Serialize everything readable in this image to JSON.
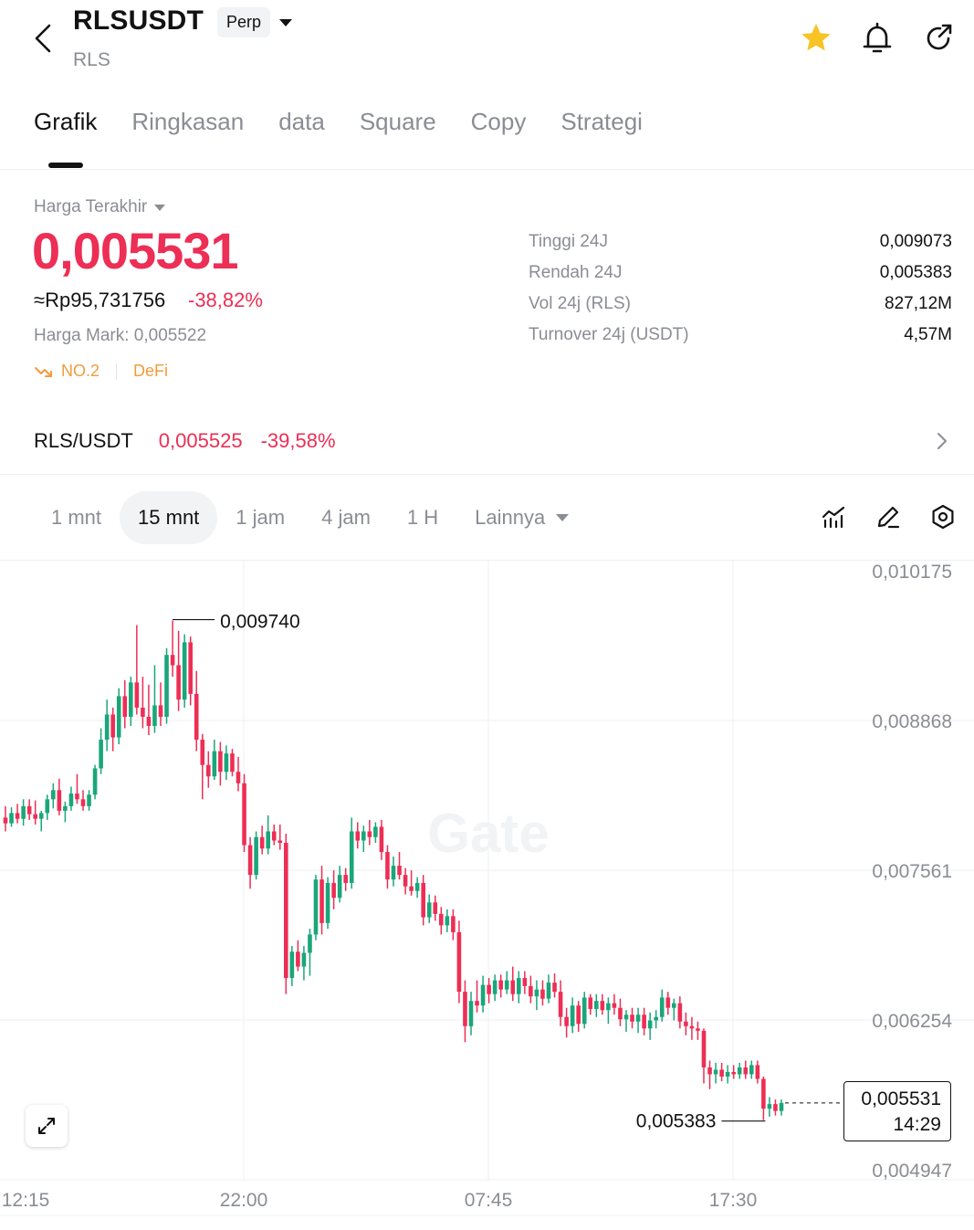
{
  "header": {
    "symbol": "RLSUSDT",
    "base": "RLS",
    "contract_tag": "Perp",
    "icons": [
      "back-icon",
      "star-icon",
      "bell-icon",
      "share-icon"
    ],
    "favorite_color": "#f7c325"
  },
  "tabs": [
    {
      "label": "Grafik",
      "active": true
    },
    {
      "label": "Ringkasan",
      "active": false
    },
    {
      "label": "data",
      "active": false
    },
    {
      "label": "Square",
      "active": false
    },
    {
      "label": "Copy",
      "active": false
    },
    {
      "label": "Strategi",
      "active": false
    }
  ],
  "price": {
    "label": "Harga Terakhir",
    "last": "0,005531",
    "idr": "≈Rp95,731756",
    "change": "-38,82%",
    "mark": "Harga Mark: 0,005522",
    "rank": "NO.2",
    "sector": "DeFi"
  },
  "stats": [
    {
      "label": "Tinggi 24J",
      "value": "0,009073"
    },
    {
      "label": "Rendah 24J",
      "value": "0,005383"
    },
    {
      "label": "Vol 24j (RLS)",
      "value": "827,12M"
    },
    {
      "label": "Turnover 24j (USDT)",
      "value": "4,57M"
    }
  ],
  "spot": {
    "pair": "RLS/USDT",
    "price": "0,005525",
    "change": "-39,58%"
  },
  "intervals": {
    "items": [
      "1 mnt",
      "15 mnt",
      "1 jam",
      "4 jam",
      "1 H"
    ],
    "selected": "15 mnt",
    "more": "Lainnya"
  },
  "colors": {
    "up": "#1aa67a",
    "down": "#ed2e55",
    "text": "#121212",
    "muted": "#8a8d93"
  },
  "chart_data": {
    "type": "candlestick",
    "interval": "15 mnt",
    "y_ticks": [
      0.010175,
      0.008868,
      0.007561,
      0.006254,
      0.004947
    ],
    "y_tick_labels": [
      "0,010175",
      "0,008868",
      "0,007561",
      "0,006254",
      "0,004947"
    ],
    "x_tick_labels": [
      "12:15",
      "22:00",
      "07:45",
      "17:30"
    ],
    "ylim": [
      0.004947,
      0.010175
    ],
    "high_marker": "0,009740",
    "low_marker": "0,005383",
    "current_price": "0,005531",
    "current_countdown": "14:29",
    "watermark": "Gate",
    "grid": true,
    "candles": [
      {
        "o": 0.00802,
        "h": 0.00812,
        "l": 0.0079,
        "c": 0.00797
      },
      {
        "o": 0.00797,
        "h": 0.00811,
        "l": 0.00794,
        "c": 0.00806
      },
      {
        "o": 0.00806,
        "h": 0.00814,
        "l": 0.00797,
        "c": 0.00801
      },
      {
        "o": 0.00801,
        "h": 0.00818,
        "l": 0.00795,
        "c": 0.00812
      },
      {
        "o": 0.00812,
        "h": 0.00818,
        "l": 0.008,
        "c": 0.00805
      },
      {
        "o": 0.00805,
        "h": 0.00817,
        "l": 0.00796,
        "c": 0.00801
      },
      {
        "o": 0.00801,
        "h": 0.00808,
        "l": 0.0079,
        "c": 0.00806
      },
      {
        "o": 0.00806,
        "h": 0.00822,
        "l": 0.008,
        "c": 0.00818
      },
      {
        "o": 0.00818,
        "h": 0.00832,
        "l": 0.0081,
        "c": 0.00826
      },
      {
        "o": 0.00826,
        "h": 0.00836,
        "l": 0.00804,
        "c": 0.00808
      },
      {
        "o": 0.00808,
        "h": 0.00816,
        "l": 0.00798,
        "c": 0.00812
      },
      {
        "o": 0.00812,
        "h": 0.00829,
        "l": 0.00808,
        "c": 0.00823
      },
      {
        "o": 0.00823,
        "h": 0.0084,
        "l": 0.00814,
        "c": 0.00818
      },
      {
        "o": 0.00818,
        "h": 0.00826,
        "l": 0.00808,
        "c": 0.00812
      },
      {
        "o": 0.00812,
        "h": 0.00826,
        "l": 0.00808,
        "c": 0.00822
      },
      {
        "o": 0.00822,
        "h": 0.00848,
        "l": 0.00818,
        "c": 0.00845
      },
      {
        "o": 0.00845,
        "h": 0.0088,
        "l": 0.0084,
        "c": 0.0087
      },
      {
        "o": 0.0087,
        "h": 0.00905,
        "l": 0.0086,
        "c": 0.00892
      },
      {
        "o": 0.00892,
        "h": 0.00898,
        "l": 0.0086,
        "c": 0.00872
      },
      {
        "o": 0.00872,
        "h": 0.00915,
        "l": 0.00866,
        "c": 0.00908
      },
      {
        "o": 0.00908,
        "h": 0.00922,
        "l": 0.0088,
        "c": 0.0089
      },
      {
        "o": 0.0089,
        "h": 0.00925,
        "l": 0.00882,
        "c": 0.0092
      },
      {
        "o": 0.0092,
        "h": 0.0097,
        "l": 0.00892,
        "c": 0.00898
      },
      {
        "o": 0.00898,
        "h": 0.00925,
        "l": 0.0088,
        "c": 0.0089
      },
      {
        "o": 0.0089,
        "h": 0.00918,
        "l": 0.00874,
        "c": 0.00882
      },
      {
        "o": 0.00882,
        "h": 0.00935,
        "l": 0.00876,
        "c": 0.009
      },
      {
        "o": 0.009,
        "h": 0.0092,
        "l": 0.00882,
        "c": 0.0089
      },
      {
        "o": 0.0089,
        "h": 0.0095,
        "l": 0.00884,
        "c": 0.00944
      },
      {
        "o": 0.00944,
        "h": 0.00974,
        "l": 0.00925,
        "c": 0.00935
      },
      {
        "o": 0.00935,
        "h": 0.00965,
        "l": 0.00895,
        "c": 0.00905
      },
      {
        "o": 0.00905,
        "h": 0.00962,
        "l": 0.00898,
        "c": 0.00955
      },
      {
        "o": 0.00955,
        "h": 0.0096,
        "l": 0.009,
        "c": 0.0091
      },
      {
        "o": 0.0091,
        "h": 0.0093,
        "l": 0.0086,
        "c": 0.0087
      },
      {
        "o": 0.0087,
        "h": 0.00875,
        "l": 0.00818,
        "c": 0.00848
      },
      {
        "o": 0.00848,
        "h": 0.0086,
        "l": 0.00828,
        "c": 0.00838
      },
      {
        "o": 0.00838,
        "h": 0.0087,
        "l": 0.00835,
        "c": 0.0086
      },
      {
        "o": 0.0086,
        "h": 0.00868,
        "l": 0.0083,
        "c": 0.00842
      },
      {
        "o": 0.00842,
        "h": 0.00865,
        "l": 0.00835,
        "c": 0.00858
      },
      {
        "o": 0.00858,
        "h": 0.00862,
        "l": 0.00838,
        "c": 0.00842
      },
      {
        "o": 0.00842,
        "h": 0.00855,
        "l": 0.00825,
        "c": 0.00832
      },
      {
        "o": 0.00832,
        "h": 0.0084,
        "l": 0.00772,
        "c": 0.00778
      },
      {
        "o": 0.00778,
        "h": 0.00785,
        "l": 0.0074,
        "c": 0.00752
      },
      {
        "o": 0.00752,
        "h": 0.0079,
        "l": 0.00748,
        "c": 0.00785
      },
      {
        "o": 0.00785,
        "h": 0.00795,
        "l": 0.0077,
        "c": 0.00775
      },
      {
        "o": 0.00775,
        "h": 0.00804,
        "l": 0.0077,
        "c": 0.0079
      },
      {
        "o": 0.0079,
        "h": 0.00796,
        "l": 0.00778,
        "c": 0.00782
      },
      {
        "o": 0.00782,
        "h": 0.00796,
        "l": 0.00774,
        "c": 0.0078
      },
      {
        "o": 0.0078,
        "h": 0.00788,
        "l": 0.00648,
        "c": 0.00662
      },
      {
        "o": 0.00662,
        "h": 0.0069,
        "l": 0.00655,
        "c": 0.00685
      },
      {
        "o": 0.00685,
        "h": 0.00695,
        "l": 0.00668,
        "c": 0.00672
      },
      {
        "o": 0.00672,
        "h": 0.0069,
        "l": 0.0066,
        "c": 0.00684
      },
      {
        "o": 0.00684,
        "h": 0.00705,
        "l": 0.00664,
        "c": 0.007
      },
      {
        "o": 0.007,
        "h": 0.00752,
        "l": 0.00695,
        "c": 0.00748
      },
      {
        "o": 0.00748,
        "h": 0.0076,
        "l": 0.007,
        "c": 0.0071
      },
      {
        "o": 0.0071,
        "h": 0.0075,
        "l": 0.00705,
        "c": 0.00745
      },
      {
        "o": 0.00745,
        "h": 0.00756,
        "l": 0.00722,
        "c": 0.00732
      },
      {
        "o": 0.00732,
        "h": 0.0076,
        "l": 0.00728,
        "c": 0.00752
      },
      {
        "o": 0.00752,
        "h": 0.00758,
        "l": 0.00738,
        "c": 0.00745
      },
      {
        "o": 0.00745,
        "h": 0.00802,
        "l": 0.0074,
        "c": 0.0079
      },
      {
        "o": 0.0079,
        "h": 0.00798,
        "l": 0.00775,
        "c": 0.00782
      },
      {
        "o": 0.00782,
        "h": 0.00795,
        "l": 0.00772,
        "c": 0.0079
      },
      {
        "o": 0.0079,
        "h": 0.008,
        "l": 0.00778,
        "c": 0.00785
      },
      {
        "o": 0.00785,
        "h": 0.00798,
        "l": 0.0078,
        "c": 0.00794
      },
      {
        "o": 0.00794,
        "h": 0.008,
        "l": 0.00765,
        "c": 0.00772
      },
      {
        "o": 0.00772,
        "h": 0.00778,
        "l": 0.0074,
        "c": 0.00748
      },
      {
        "o": 0.00748,
        "h": 0.00768,
        "l": 0.00742,
        "c": 0.0076
      },
      {
        "o": 0.0076,
        "h": 0.00772,
        "l": 0.00748,
        "c": 0.00752
      },
      {
        "o": 0.00752,
        "h": 0.00758,
        "l": 0.00735,
        "c": 0.00742
      },
      {
        "o": 0.00742,
        "h": 0.00756,
        "l": 0.00734,
        "c": 0.00738
      },
      {
        "o": 0.00738,
        "h": 0.0075,
        "l": 0.00732,
        "c": 0.00745
      },
      {
        "o": 0.00745,
        "h": 0.00752,
        "l": 0.00708,
        "c": 0.00715
      },
      {
        "o": 0.00715,
        "h": 0.00735,
        "l": 0.0071,
        "c": 0.00728
      },
      {
        "o": 0.00728,
        "h": 0.00734,
        "l": 0.00712,
        "c": 0.00718
      },
      {
        "o": 0.00718,
        "h": 0.00724,
        "l": 0.007,
        "c": 0.00708
      },
      {
        "o": 0.00708,
        "h": 0.00722,
        "l": 0.00702,
        "c": 0.00716
      },
      {
        "o": 0.00716,
        "h": 0.00722,
        "l": 0.00695,
        "c": 0.00702
      },
      {
        "o": 0.00702,
        "h": 0.00712,
        "l": 0.0064,
        "c": 0.0065
      },
      {
        "o": 0.0065,
        "h": 0.0066,
        "l": 0.00606,
        "c": 0.0062
      },
      {
        "o": 0.0062,
        "h": 0.0065,
        "l": 0.00612,
        "c": 0.00642
      },
      {
        "o": 0.00642,
        "h": 0.0066,
        "l": 0.00632,
        "c": 0.00638
      },
      {
        "o": 0.00638,
        "h": 0.00664,
        "l": 0.00632,
        "c": 0.00656
      },
      {
        "o": 0.00656,
        "h": 0.00662,
        "l": 0.0064,
        "c": 0.00648
      },
      {
        "o": 0.00648,
        "h": 0.00665,
        "l": 0.00642,
        "c": 0.0066
      },
      {
        "o": 0.0066,
        "h": 0.00665,
        "l": 0.00645,
        "c": 0.00652
      },
      {
        "o": 0.00652,
        "h": 0.00668,
        "l": 0.00648,
        "c": 0.0066
      },
      {
        "o": 0.0066,
        "h": 0.00672,
        "l": 0.00642,
        "c": 0.00648
      },
      {
        "o": 0.00648,
        "h": 0.00668,
        "l": 0.0064,
        "c": 0.00662
      },
      {
        "o": 0.00662,
        "h": 0.00668,
        "l": 0.00648,
        "c": 0.00655
      },
      {
        "o": 0.00655,
        "h": 0.00664,
        "l": 0.0064,
        "c": 0.00646
      },
      {
        "o": 0.00646,
        "h": 0.0066,
        "l": 0.00634,
        "c": 0.00652
      },
      {
        "o": 0.00652,
        "h": 0.0066,
        "l": 0.00638,
        "c": 0.00644
      },
      {
        "o": 0.00644,
        "h": 0.00665,
        "l": 0.0064,
        "c": 0.00658
      },
      {
        "o": 0.00658,
        "h": 0.00666,
        "l": 0.00645,
        "c": 0.0065
      },
      {
        "o": 0.0065,
        "h": 0.0066,
        "l": 0.0062,
        "c": 0.00628
      },
      {
        "o": 0.00628,
        "h": 0.00636,
        "l": 0.0061,
        "c": 0.0062
      },
      {
        "o": 0.0062,
        "h": 0.00645,
        "l": 0.00614,
        "c": 0.00638
      },
      {
        "o": 0.00638,
        "h": 0.00642,
        "l": 0.00615,
        "c": 0.00622
      },
      {
        "o": 0.00622,
        "h": 0.0065,
        "l": 0.00618,
        "c": 0.00645
      },
      {
        "o": 0.00645,
        "h": 0.00648,
        "l": 0.0063,
        "c": 0.00635
      },
      {
        "o": 0.00635,
        "h": 0.00648,
        "l": 0.00628,
        "c": 0.00642
      },
      {
        "o": 0.00642,
        "h": 0.00648,
        "l": 0.0063,
        "c": 0.00634
      },
      {
        "o": 0.00634,
        "h": 0.00645,
        "l": 0.00622,
        "c": 0.0064
      },
      {
        "o": 0.0064,
        "h": 0.00648,
        "l": 0.0063,
        "c": 0.00636
      },
      {
        "o": 0.00636,
        "h": 0.00644,
        "l": 0.0062,
        "c": 0.00626
      },
      {
        "o": 0.00626,
        "h": 0.00634,
        "l": 0.00615,
        "c": 0.0063
      },
      {
        "o": 0.0063,
        "h": 0.00636,
        "l": 0.00618,
        "c": 0.00624
      },
      {
        "o": 0.00624,
        "h": 0.00636,
        "l": 0.00614,
        "c": 0.0063
      },
      {
        "o": 0.0063,
        "h": 0.00636,
        "l": 0.00612,
        "c": 0.00618
      },
      {
        "o": 0.00618,
        "h": 0.00632,
        "l": 0.00608,
        "c": 0.00625
      },
      {
        "o": 0.00625,
        "h": 0.00634,
        "l": 0.00618,
        "c": 0.00628
      },
      {
        "o": 0.00628,
        "h": 0.00652,
        "l": 0.00624,
        "c": 0.00645
      },
      {
        "o": 0.00645,
        "h": 0.0065,
        "l": 0.0063,
        "c": 0.00636
      },
      {
        "o": 0.00636,
        "h": 0.00644,
        "l": 0.00625,
        "c": 0.0064
      },
      {
        "o": 0.0064,
        "h": 0.00646,
        "l": 0.00618,
        "c": 0.00624
      },
      {
        "o": 0.00624,
        "h": 0.00632,
        "l": 0.00612,
        "c": 0.0062
      },
      {
        "o": 0.0062,
        "h": 0.00628,
        "l": 0.00608,
        "c": 0.00618
      },
      {
        "o": 0.00618,
        "h": 0.00624,
        "l": 0.00608,
        "c": 0.00616
      },
      {
        "o": 0.00616,
        "h": 0.00618,
        "l": 0.0057,
        "c": 0.00584
      },
      {
        "o": 0.00584,
        "h": 0.0059,
        "l": 0.00565,
        "c": 0.00578
      },
      {
        "o": 0.00578,
        "h": 0.00588,
        "l": 0.0057,
        "c": 0.00582
      },
      {
        "o": 0.00582,
        "h": 0.00588,
        "l": 0.00572,
        "c": 0.00576
      },
      {
        "o": 0.00576,
        "h": 0.00586,
        "l": 0.0057,
        "c": 0.0058
      },
      {
        "o": 0.0058,
        "h": 0.00586,
        "l": 0.00574,
        "c": 0.00578
      },
      {
        "o": 0.00578,
        "h": 0.00588,
        "l": 0.00574,
        "c": 0.00584
      },
      {
        "o": 0.00584,
        "h": 0.0059,
        "l": 0.00574,
        "c": 0.00578
      },
      {
        "o": 0.00578,
        "h": 0.0059,
        "l": 0.00574,
        "c": 0.00586
      },
      {
        "o": 0.00586,
        "h": 0.0059,
        "l": 0.0057,
        "c": 0.00574
      },
      {
        "o": 0.00574,
        "h": 0.00576,
        "l": 0.00538,
        "c": 0.00548
      },
      {
        "o": 0.00548,
        "h": 0.00558,
        "l": 0.00541,
        "c": 0.00552
      },
      {
        "o": 0.00552,
        "h": 0.00556,
        "l": 0.00542,
        "c": 0.00546
      },
      {
        "o": 0.00546,
        "h": 0.00556,
        "l": 0.00542,
        "c": 0.00553
      }
    ]
  }
}
